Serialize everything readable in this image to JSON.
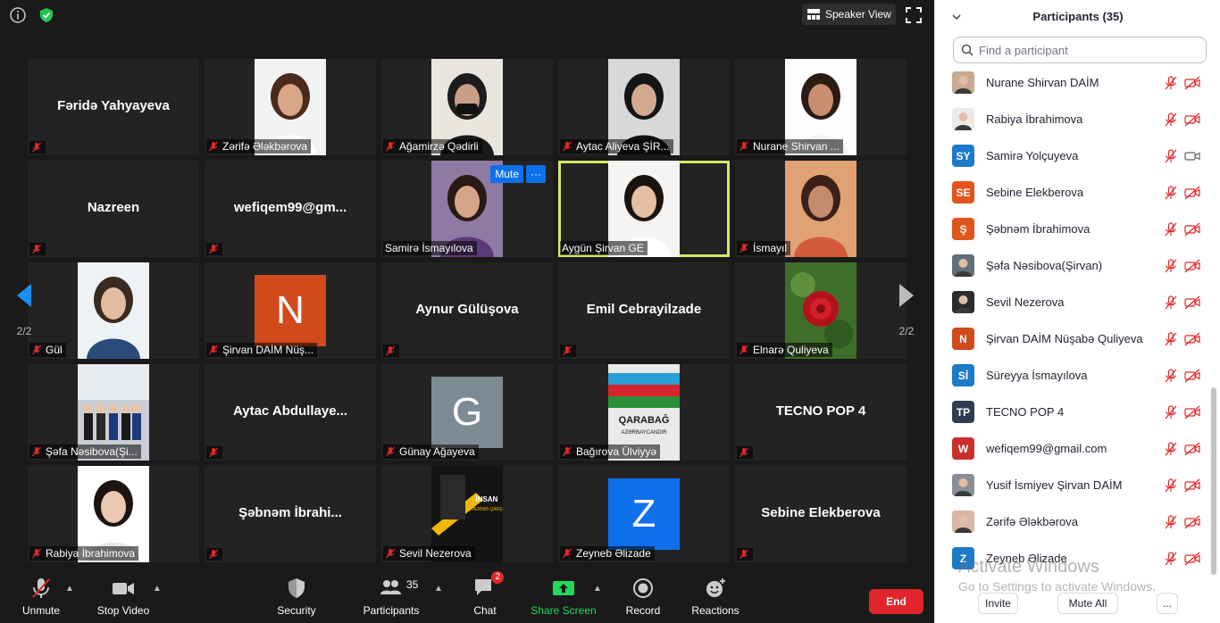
{
  "window": {
    "speaker_view_label": "Speaker View"
  },
  "tiles": [
    {
      "name": "Fəridə Yahyayeva",
      "kind": "name",
      "label": ""
    },
    {
      "name": "",
      "kind": "photo",
      "label": "Zərifə Ələkbərova",
      "photo": "woman-smiling"
    },
    {
      "name": "",
      "kind": "photo",
      "label": "Ağamirzə Qədirli",
      "photo": "man-mask"
    },
    {
      "name": "",
      "kind": "photo",
      "label": "Aytac Aliyeva ŞİR...",
      "photo": "woman-dark"
    },
    {
      "name": "",
      "kind": "photo",
      "label": "Nurane Shirvan ...",
      "photo": "woman-hat"
    },
    {
      "name": "Nazreen",
      "kind": "name",
      "label": ""
    },
    {
      "name": "wefiqem99@gm...",
      "kind": "name",
      "label": ""
    },
    {
      "name": "",
      "kind": "photo",
      "label": "Samirə İsmayılova",
      "photo": "woman-purple",
      "mute_label": "Mute",
      "more_label": "···"
    },
    {
      "name": "",
      "kind": "photo",
      "label": "Aygün Şirvan GE",
      "photo": "woman-speaking",
      "active": true
    },
    {
      "name": "",
      "kind": "photo",
      "label": "İsmayıl",
      "photo": "woman-orange"
    },
    {
      "name": "",
      "kind": "photo",
      "label": "Gül",
      "photo": "girl-white"
    },
    {
      "name": "N",
      "kind": "letter",
      "label": "Şirvan DAİM Nüş...",
      "color": "#d14a1c"
    },
    {
      "name": "Aynur Gülüşova",
      "kind": "name",
      "label": ""
    },
    {
      "name": "Emil Cebrayilzade",
      "kind": "name",
      "label": ""
    },
    {
      "name": "",
      "kind": "photo",
      "label": "Elnarə Quliyeva",
      "photo": "rose"
    },
    {
      "name": "",
      "kind": "photo",
      "label": "Şəfa Nəsibova(Şi...",
      "photo": "group"
    },
    {
      "name": "Aytac  Abdullaye...",
      "kind": "name",
      "label": ""
    },
    {
      "name": "G",
      "kind": "letter",
      "label": "Günay Ağayeva",
      "color": "#7d8c94"
    },
    {
      "name": "",
      "kind": "photo",
      "label": "Bağırova Ülviyyə",
      "photo": "flag-poster",
      "poster_text_1": "QARABAĞ",
      "poster_text_2": "AZƏRBAYCANDIR"
    },
    {
      "name": "TECNO POP 4",
      "kind": "name",
      "label": ""
    },
    {
      "name": "",
      "kind": "photo",
      "label": "Rabiya İbrahimova",
      "photo": "girl-long-hair"
    },
    {
      "name": "Şəbnəm  İbrahi...",
      "kind": "name",
      "label": ""
    },
    {
      "name": "",
      "kind": "photo",
      "label": "Sevil Nezerova",
      "photo": "poster-dark",
      "poster_text_1": "İNSAN",
      "poster_text_2": "ALVERİNƏ QARŞI"
    },
    {
      "name": "Z",
      "kind": "letter",
      "label": "Zeyneb Əlizade",
      "color": "#0e71eb"
    },
    {
      "name": "Sebine Elekberova",
      "kind": "name",
      "label": ""
    }
  ],
  "pager": {
    "left_page": "2/2",
    "right_page": "2/2"
  },
  "toolbar": {
    "unmute": "Unmute",
    "stop_video": "Stop Video",
    "security": "Security",
    "participants": "Participants",
    "participants_count": "35",
    "chat": "Chat",
    "chat_badge": "2",
    "share_screen": "Share Screen",
    "record": "Record",
    "reactions": "Reactions",
    "end": "End"
  },
  "panel": {
    "title": "Participants (35)",
    "search_placeholder": "Find a participant",
    "participants": [
      {
        "name": "Nurane Shirvan DAİM",
        "avatar": "photo",
        "color": "#c9a98f",
        "camera": "off"
      },
      {
        "name": "Rabiya İbrahimova",
        "avatar": "photo",
        "color": "#ece9e6",
        "camera": "off"
      },
      {
        "name": "Samirə Yolçuyeva",
        "avatar": "SY",
        "color": "#1c7ac9",
        "camera": "on"
      },
      {
        "name": "Sebine Elekberova",
        "avatar": "SE",
        "color": "#e0551b",
        "camera": "off"
      },
      {
        "name": "Şəbnəm İbrahimova",
        "avatar": "Ş",
        "color": "#e0551b",
        "camera": "off"
      },
      {
        "name": "Şəfa Nəsibova(Şirvan)",
        "avatar": "photo",
        "color": "#5f6f7c",
        "camera": "off"
      },
      {
        "name": "Sevil Nezerova",
        "avatar": "photo",
        "color": "#2b2b2b",
        "camera": "off"
      },
      {
        "name": "Şirvan DAİM Nüşabə Quliyeva",
        "avatar": "N",
        "color": "#d14a1c",
        "camera": "off"
      },
      {
        "name": "Süreyya İsmayılova",
        "avatar": "Sİ",
        "color": "#1c7ac9",
        "camera": "off"
      },
      {
        "name": "TECNO POP 4",
        "avatar": "TP",
        "color": "#2c3e50",
        "camera": "off"
      },
      {
        "name": "wefiqem99@gmail.com",
        "avatar": "W",
        "color": "#c8302b",
        "camera": "off"
      },
      {
        "name": "Yusif İsmiyev  Şirvan DAİM",
        "avatar": "photo",
        "color": "#8a8f96",
        "camera": "off"
      },
      {
        "name": "Zərifə Ələkbərova",
        "avatar": "photo",
        "color": "#d9b7a5",
        "camera": "off"
      },
      {
        "name": "Zeyneb Əlizade",
        "avatar": "Z",
        "color": "#1c7ac9",
        "camera": "off"
      }
    ],
    "invite": "Invite",
    "mute_all": "Mute All",
    "more": "..."
  },
  "watermark": {
    "line1": "Activate Windows",
    "line2": "Go to Settings to activate Windows."
  },
  "colors": {
    "accent_blue": "#0e71eb",
    "mute_red": "#e02828",
    "active_speaker": "#d8e66b",
    "share_green": "#23d95a",
    "end_red": "#e0262b"
  }
}
